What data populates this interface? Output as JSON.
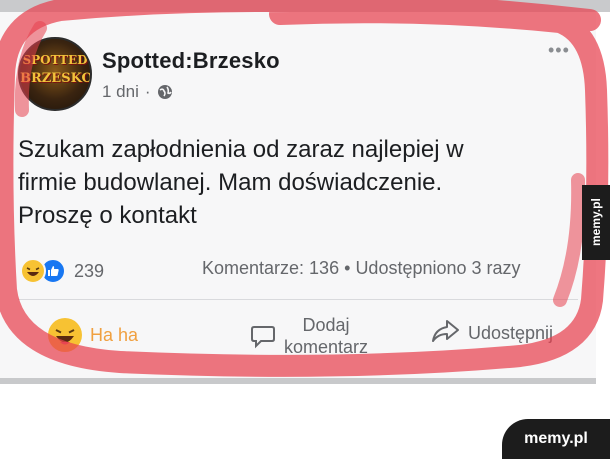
{
  "post": {
    "page_name": "Spotted:Brzesko",
    "time": "1 dni",
    "time_separator": "·",
    "more_label": "•••",
    "avatar": {
      "line1": "SPOTTED",
      "line2": "BRZESKO"
    },
    "text_lines": [
      "Szukam zapłodnienia od zaraz  najlepiej w",
      "firmie budowlanej. Mam doświadczenie.",
      "Proszę o kontakt"
    ]
  },
  "stats": {
    "reaction_count": "239",
    "comments": "Komentarze: 136",
    "separator": "•",
    "shares": "Udostępniono 3 razy"
  },
  "actions": {
    "haha_label": "Ha ha",
    "comment_line1": "Dodaj",
    "comment_line2": "komentarz",
    "share_label": "Udostępnij"
  },
  "watermark": {
    "side": "memy.pl",
    "corner": "memy.pl"
  },
  "colors": {
    "scribble": "#e8414f",
    "like_blue": "#1877f2",
    "haha_yellow": "#f7c233",
    "text": "#1c1e21",
    "muted": "#65676b"
  },
  "icons": [
    "globe-icon",
    "more-icon",
    "haha-reaction-icon",
    "like-reaction-icon",
    "comment-icon",
    "share-icon"
  ]
}
